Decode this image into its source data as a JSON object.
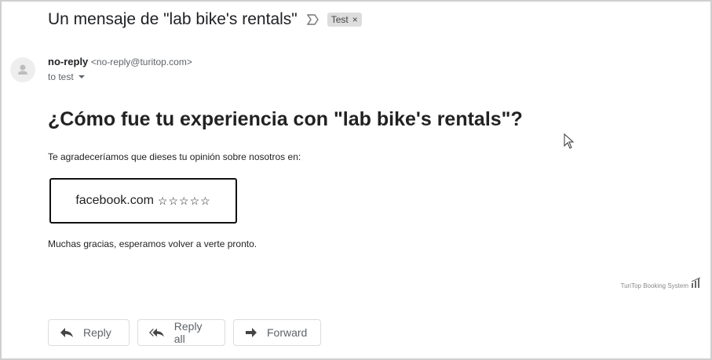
{
  "email": {
    "subject": "Un mensaje de \"lab bike's rentals\"",
    "tag_label": "Test",
    "tag_close": "×",
    "sender_name": "no-reply",
    "sender_email": "<no-reply@turitop.com>",
    "to_line": "to test"
  },
  "body": {
    "heading": "¿Cómo fue tu experiencia con \"lab bike's rentals\"?",
    "intro": "Te agradeceríamos que dieses tu opinión sobre nosotros en:",
    "review_site": "facebook.com",
    "review_stars": "☆☆☆☆☆",
    "thanks": "Muchas gracias, esperamos volver a verte pronto.",
    "brand": "TuriTop Booking System"
  },
  "actions": {
    "reply": "Reply",
    "reply_all": "Reply all",
    "forward": "Forward"
  },
  "icons": [
    "label-arrow-icon",
    "avatar-person-icon",
    "chevron-down-icon",
    "reply-icon",
    "reply-all-icon",
    "forward-icon",
    "turitop-logo-icon",
    "mouse-cursor-icon"
  ],
  "colors": {
    "tag_bg": "#dddddd",
    "text": "#202124",
    "muted": "#5f6368",
    "border": "#dadce0"
  }
}
